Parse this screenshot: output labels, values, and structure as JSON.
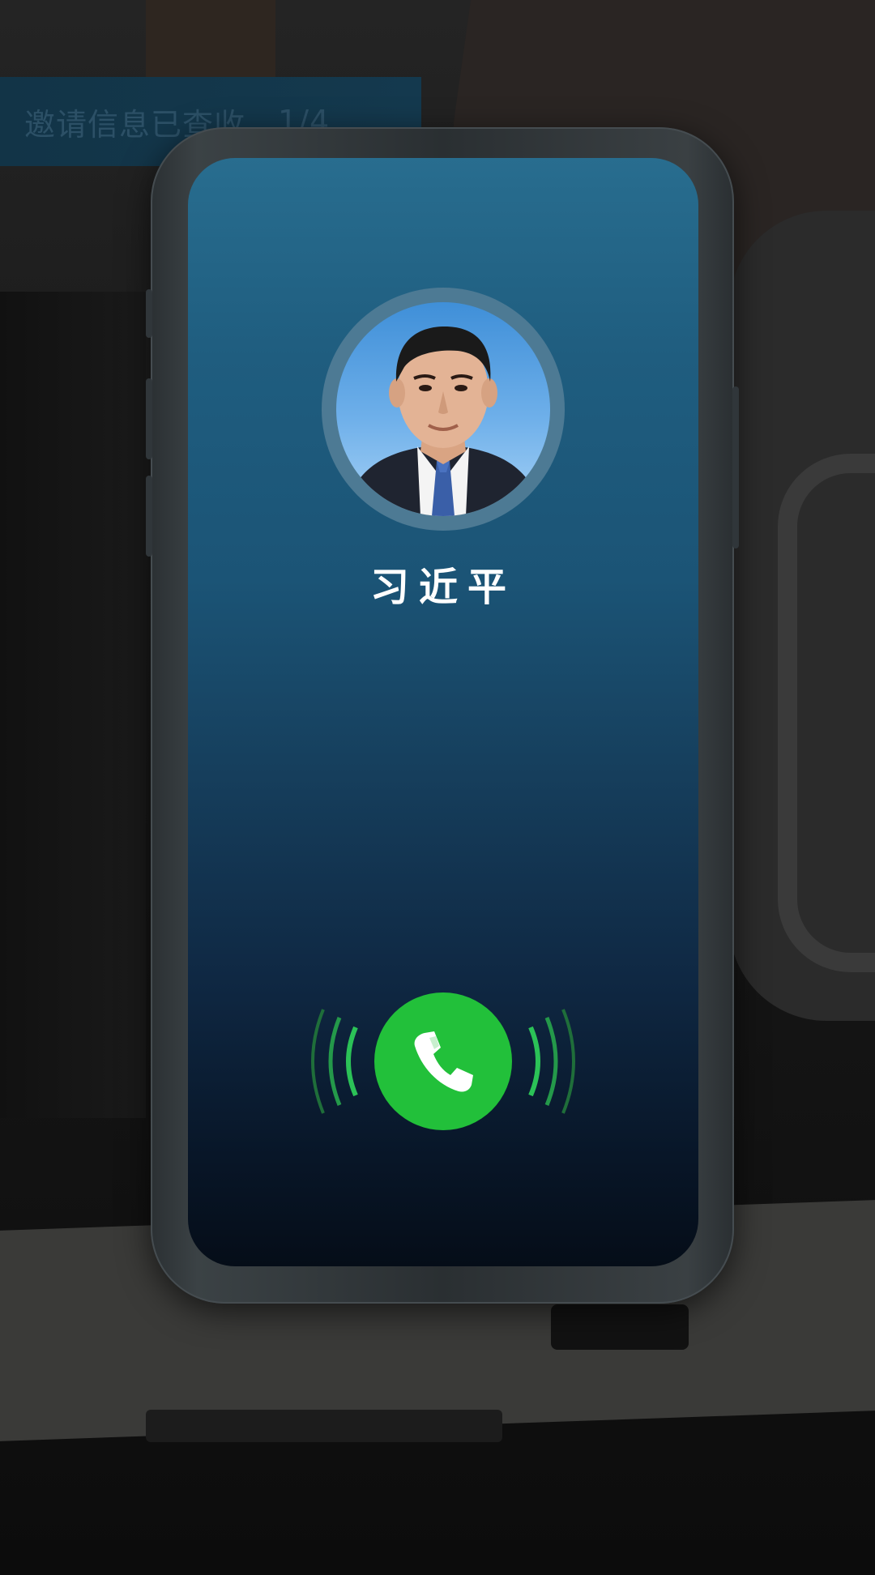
{
  "banner": {
    "text": "邀请信息已查收",
    "count": "1/4"
  },
  "call": {
    "caller_name": "习近平",
    "answer_icon": "phone-handset-icon",
    "answer_color": "#22c03a"
  }
}
